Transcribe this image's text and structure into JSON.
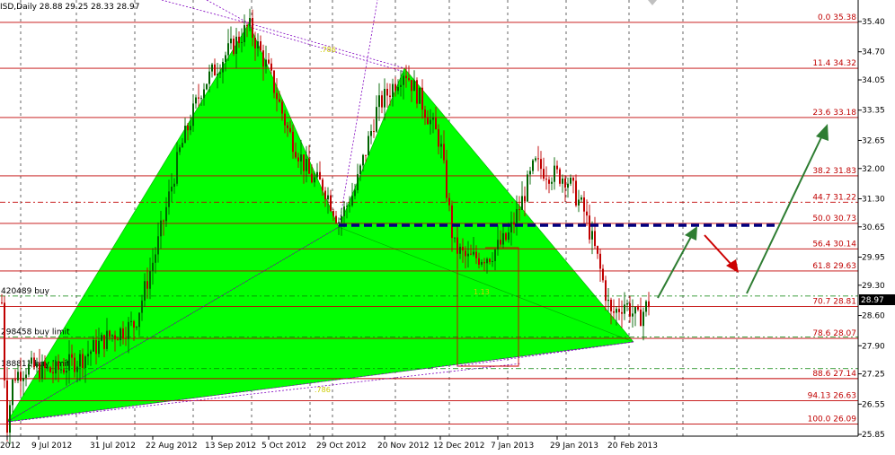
{
  "header": "ISD,Daily  28.88 29.25 28.33 28.97",
  "chart_data": {
    "type": "candlestick",
    "title": "ISD,Daily",
    "ohlc_header": {
      "open": 28.88,
      "high": 29.25,
      "low": 28.33,
      "close": 28.97
    },
    "last_price": "28.97",
    "x_ticks": [
      "2012",
      "9 Jul 2012",
      "31 Jul 2012",
      "22 Aug 2012",
      "13 Sep 2012",
      "5 Oct 2012",
      "29 Oct 2012",
      "20 Nov 2012",
      "12 Dec 2012",
      "7 Jan 2013",
      "29 Jan 2013",
      "20 Feb 2013"
    ],
    "y_ticks": [
      "35.40",
      "34.70",
      "34.05",
      "33.35",
      "32.65",
      "32.00",
      "31.30",
      "30.65",
      "29.95",
      "29.30",
      "28.60",
      "27.90",
      "27.25",
      "26.55",
      "25.85"
    ],
    "ylim": [
      25.85,
      35.4
    ],
    "fib_levels": [
      {
        "label": "0.0 35.38",
        "value": 35.38
      },
      {
        "label": "11.4 34.32",
        "value": 34.32
      },
      {
        "label": "23.6 33.18",
        "value": 33.18
      },
      {
        "label": "38.2 31.83",
        "value": 31.83
      },
      {
        "label": "44.7 31.22",
        "value": 31.22
      },
      {
        "label": "50.0 30.73",
        "value": 30.73
      },
      {
        "label": "56.4 30.14",
        "value": 30.14
      },
      {
        "label": "61.8 29.63",
        "value": 29.63
      },
      {
        "label": "70.7 28.81",
        "value": 28.81
      },
      {
        "label": "78.6 28.07",
        "value": 28.07
      },
      {
        "label": "88.6 27.14",
        "value": 27.14
      },
      {
        "label": "94.13 26.63",
        "value": 26.63
      },
      {
        "label": "100.0 26.09",
        "value": 26.09
      }
    ],
    "orders": [
      {
        "label": "420489 buy",
        "value": 29.05
      },
      {
        "label": "298458 buy limit",
        "value": 28.1
      },
      {
        "label": "188811 buy limit",
        "value": 27.37
      }
    ],
    "pattern_labels": [
      ".786",
      "1.13",
      ".786"
    ],
    "colors": {
      "pattern_fill": "#00ff00",
      "fib_line": "#c00000",
      "bull_candle": "#006400",
      "bear_candle": "#c00000",
      "dashed_level": "#000080",
      "arrow_up": "#2e7d32",
      "arrow_down": "#cc0000",
      "grid": "#000000"
    }
  }
}
